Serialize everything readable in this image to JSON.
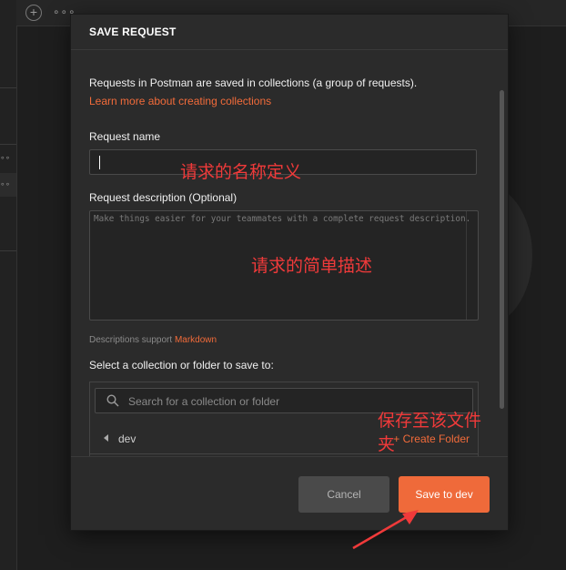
{
  "modal": {
    "title": "SAVE REQUEST",
    "intro": "Requests in Postman are saved in collections (a group of requests).",
    "learn_link": "Learn more about creating collections",
    "request_name_label": "Request name",
    "request_name_value": "",
    "request_desc_label": "Request description (Optional)",
    "request_desc_placeholder": "Make things easier for your teammates with a complete request description.",
    "markdown_note": "Descriptions support",
    "markdown_link": "Markdown",
    "save_to_label": "Select a collection or folder to save to:",
    "search_placeholder": "Search for a collection or folder",
    "folder_name": "dev",
    "create_folder": "+ Create Folder",
    "cancel_label": "Cancel",
    "save_label": "Save to dev"
  },
  "annotations": {
    "name_note": "请求的名称定义",
    "desc_note": "请求的简单描述",
    "folder_note_line1": "保存至该文件",
    "folder_note_line2": "夹"
  },
  "colors": {
    "accent": "#ef6a3a",
    "annotation": "#f03a3a",
    "modal_bg": "#2b2b2b"
  },
  "icons": [
    "plus-circle-icon",
    "more-icon",
    "search-icon",
    "caret-left-icon",
    "arrow-annotation"
  ]
}
